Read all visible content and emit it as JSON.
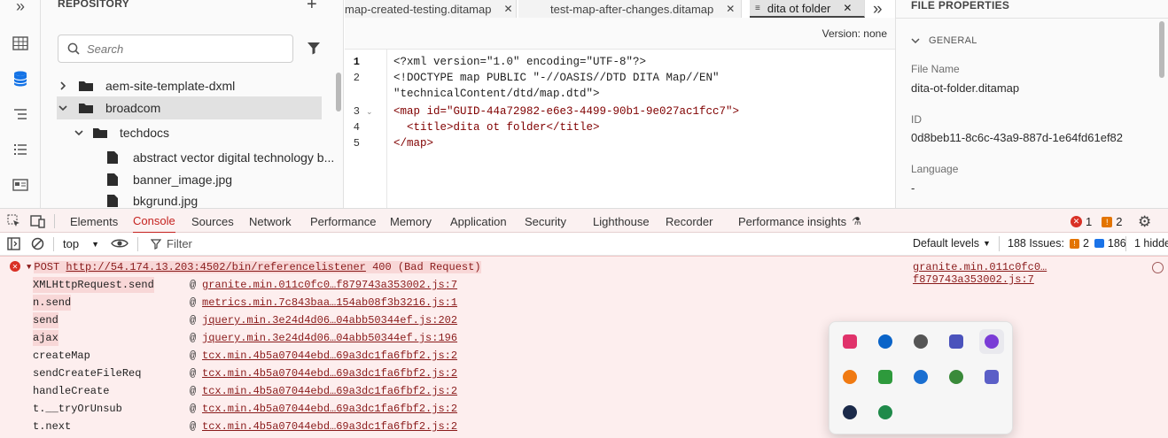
{
  "repo": {
    "title": "REPOSITORY",
    "add_label": "+",
    "search_placeholder": "Search",
    "tree": [
      {
        "label": "aem-site-template-dxml",
        "type": "folder",
        "expanded": false
      },
      {
        "label": "broadcom",
        "type": "folder",
        "expanded": true,
        "selected": true
      },
      {
        "label": "techdocs",
        "type": "folder",
        "expanded": true
      },
      {
        "label": "abstract vector digital technology b...",
        "type": "file"
      },
      {
        "label": "banner_image.jpg",
        "type": "file"
      },
      {
        "label": "bkgrund.jpg",
        "type": "file"
      }
    ]
  },
  "rail": {
    "collapse_label": "»"
  },
  "editor": {
    "tabs": [
      {
        "label": "map-created-testing.ditamap",
        "close": "✕"
      },
      {
        "label": "test-map-after-changes.ditamap",
        "close": "✕"
      },
      {
        "label": "dita ot folder",
        "close": "✕",
        "active": true
      }
    ],
    "overflow_label": "»",
    "version": "Version: none",
    "line_numbers": [
      "1",
      "2",
      "3",
      "4",
      "5"
    ],
    "lines": [
      "<?xml version=\"1.0\" encoding=\"UTF-8\"?>",
      "<!DOCTYPE map PUBLIC \"-//OASIS//DTD DITA Map//EN\"",
      "\"technicalContent/dtd/map.dtd\">",
      "<map id=\"GUID-44a72982-e6e3-4499-90b1-9e027ac1fcc7\">",
      "  <title>dita ot folder</title>",
      "</map>"
    ]
  },
  "props": {
    "title": "FILE PROPERTIES",
    "section": "GENERAL",
    "fields": [
      {
        "label": "File Name",
        "value": "dita-ot-folder.ditamap"
      },
      {
        "label": "ID",
        "value": "0d8beb11-8c6c-43a9-887d-1e64fd61ef82"
      },
      {
        "label": "Language",
        "value": "-"
      }
    ]
  },
  "devtools": {
    "tabs": [
      "Elements",
      "Console",
      "Sources",
      "Network",
      "Performance",
      "Memory",
      "Application",
      "Security",
      "Lighthouse",
      "Recorder",
      "Performance insights"
    ],
    "active_tab": "Console",
    "error_count": "1",
    "warning_count": "2",
    "context": "top",
    "filter_placeholder": "Filter",
    "levels": "Default levels",
    "issues_label": "188 Issues:",
    "issues_warn": "2",
    "issues_info": "186",
    "hidden_label": "1 hidde",
    "error": {
      "method": "POST",
      "url": "http://54.174.13.203:4502/bin/referencelistener",
      "status": "400 (Bad Request)",
      "source": "granite.min.011c0fc0…f879743a353002.js:7"
    },
    "stack": [
      {
        "fn": "XMLHttpRequest.send",
        "src": "granite.min.011c0fc0…f879743a353002.js:7"
      },
      {
        "fn": "n.send",
        "src": "metrics.min.7c843baa…154ab08f3b3216.js:1"
      },
      {
        "fn": "send",
        "src": "jquery.min.3e24d4d06…04abb50344ef.js:202"
      },
      {
        "fn": "ajax",
        "src": "jquery.min.3e24d4d06…04abb50344ef.js:196"
      },
      {
        "fn": "createMap",
        "src": "tcx.min.4b5a07044ebd…69a3dc1fa6fbf2.js:2"
      },
      {
        "fn": "sendCreateFileReq",
        "src": "tcx.min.4b5a07044ebd…69a3dc1fa6fbf2.js:2"
      },
      {
        "fn": "handleCreate",
        "src": "tcx.min.4b5a07044ebd…69a3dc1fa6fbf2.js:2"
      },
      {
        "fn": "t.__tryOrUnsub",
        "src": "tcx.min.4b5a07044ebd…69a3dc1fa6fbf2.js:2"
      },
      {
        "fn": "t.next",
        "src": "tcx.min.4b5a07044ebd…69a3dc1fa6fbf2.js:2"
      }
    ],
    "at_label": "@"
  },
  "tray_apps": [
    {
      "icon": "cube-app-icon",
      "color": "#e0336b"
    },
    {
      "icon": "onedrive-icon",
      "color": "#0a64c8"
    },
    {
      "icon": "link-app-icon",
      "color": "#555555"
    },
    {
      "icon": "teams-chat-icon",
      "color": "#4b53bc"
    },
    {
      "icon": "feather-app-icon",
      "color": "#7a3cd6"
    },
    {
      "icon": "vpn-shield-icon",
      "color": "#f07a12"
    },
    {
      "icon": "green-box-icon",
      "color": "#2e9a3c"
    },
    {
      "icon": "security-warning-icon",
      "color": "#1a6fd1"
    },
    {
      "icon": "globe-app-icon",
      "color": "#3a8a3a"
    },
    {
      "icon": "teams-icon",
      "color": "#5b5fc7"
    },
    {
      "icon": "webex-icon",
      "color": "#1b2a4a"
    },
    {
      "icon": "green-monitor-icon",
      "color": "#1f8a4a"
    }
  ]
}
